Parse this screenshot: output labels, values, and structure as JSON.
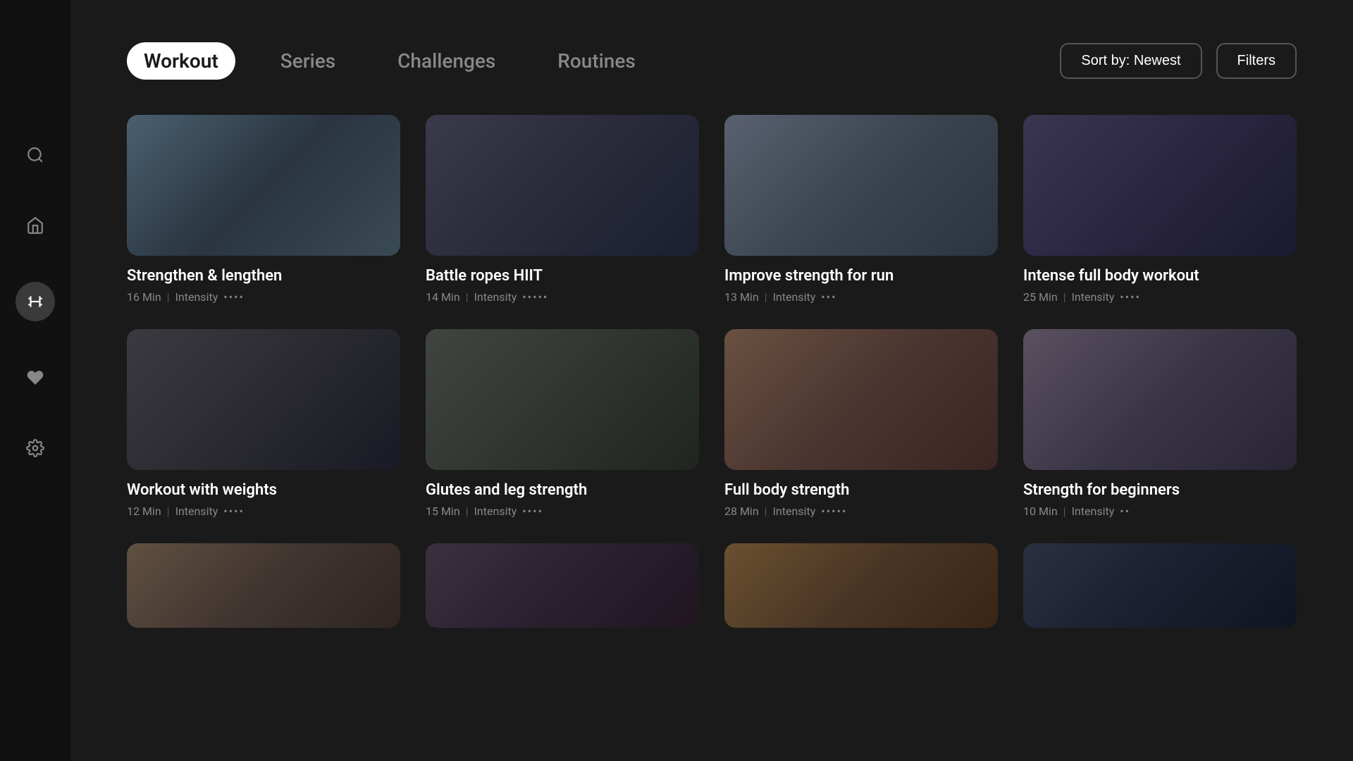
{
  "sidebar": {
    "icons": [
      {
        "name": "search",
        "label": "Search",
        "active": false
      },
      {
        "name": "home",
        "label": "Home",
        "active": false
      },
      {
        "name": "workout",
        "label": "Workout",
        "active": true
      },
      {
        "name": "favorites",
        "label": "Favorites",
        "active": false
      },
      {
        "name": "settings",
        "label": "Settings",
        "active": false
      }
    ]
  },
  "nav": {
    "tabs": [
      {
        "label": "Workout",
        "active": true
      },
      {
        "label": "Series",
        "active": false
      },
      {
        "label": "Challenges",
        "active": false
      },
      {
        "label": "Routines",
        "active": false
      }
    ],
    "sort_button": "Sort by: Newest",
    "filter_button": "Filters"
  },
  "workouts": {
    "row1": [
      {
        "title": "Strengthen & lengthen",
        "duration": "16 Min",
        "intensity_label": "Intensity",
        "intensity_dots": "••••",
        "thumb_class": "thumb-1"
      },
      {
        "title": "Battle ropes HIIT",
        "duration": "14 Min",
        "intensity_label": "Intensity",
        "intensity_dots": "•••••",
        "thumb_class": "thumb-2"
      },
      {
        "title": "Improve strength for run",
        "duration": "13 Min",
        "intensity_label": "Intensity",
        "intensity_dots": "•••",
        "thumb_class": "thumb-3"
      },
      {
        "title": "Intense full body workout",
        "duration": "25 Min",
        "intensity_label": "Intensity",
        "intensity_dots": "••••",
        "thumb_class": "thumb-4"
      }
    ],
    "row2": [
      {
        "title": "Workout with weights",
        "duration": "12 Min",
        "intensity_label": "Intensity",
        "intensity_dots": "••••",
        "thumb_class": "thumb-5"
      },
      {
        "title": "Glutes and leg strength",
        "duration": "15 Min",
        "intensity_label": "Intensity",
        "intensity_dots": "••••",
        "thumb_class": "thumb-6"
      },
      {
        "title": "Full body strength",
        "duration": "28 Min",
        "intensity_label": "Intensity",
        "intensity_dots": "•••••",
        "thumb_class": "thumb-7"
      },
      {
        "title": "Strength for beginners",
        "duration": "10 Min",
        "intensity_label": "Intensity",
        "intensity_dots": "••",
        "thumb_class": "thumb-8"
      }
    ],
    "row3": [
      {
        "thumb_class": "thumb-9"
      },
      {
        "thumb_class": "thumb-10"
      },
      {
        "thumb_class": "thumb-11"
      },
      {
        "thumb_class": "thumb-12"
      }
    ]
  }
}
